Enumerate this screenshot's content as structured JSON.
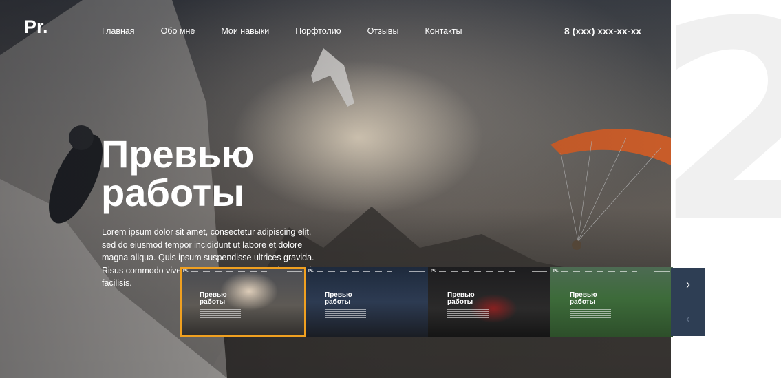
{
  "logo": "Pr.",
  "nav": [
    {
      "label": "Главная"
    },
    {
      "label": "Обо мне"
    },
    {
      "label": "Мои навыки"
    },
    {
      "label": "Порфтолио"
    },
    {
      "label": "Отзывы"
    },
    {
      "label": "Контакты"
    }
  ],
  "phone": "8 (xxx) xxx-xx-xx",
  "hero": {
    "title_line1": "Превью",
    "title_line2": "работы",
    "description": "Lorem ipsum dolor sit amet, consectetur adipiscing elit, sed do eiusmod tempor incididunt ut labore et dolore magna aliqua. Quis ipsum suspendisse ultrices gravida. Risus commodo viverra maecenas accumsan lacus vel facilisis."
  },
  "big_number": "2",
  "thumbnails": [
    {
      "logo": "Pr.",
      "title_line1": "Превью",
      "title_line2": "работы",
      "active": true
    },
    {
      "logo": "Pr.",
      "title_line1": "Превью",
      "title_line2": "работы",
      "active": false
    },
    {
      "logo": "Pr.",
      "title_line1": "Превью",
      "title_line2": "работы",
      "active": false
    },
    {
      "logo": "Pr.",
      "title_line1": "Превью",
      "title_line2": "работы",
      "active": false
    }
  ],
  "arrows": {
    "next_icon": "chevron-right-icon",
    "prev_icon": "chevron-left-icon",
    "next_glyph": "›",
    "prev_glyph": "‹"
  },
  "colors": {
    "accent": "#f0a020",
    "arrow_panel": "#2e3e54",
    "big_number": "#f0f0f0"
  }
}
